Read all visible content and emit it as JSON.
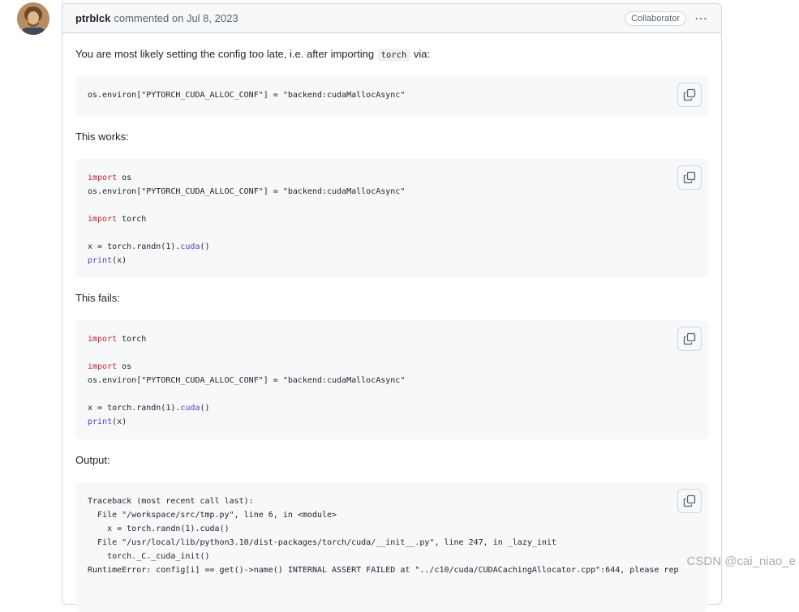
{
  "comment": {
    "author": "ptrblck",
    "meta": "commented on Jul 8, 2023",
    "badge": "Collaborator",
    "menu_icon": "kebab-horizontal-icon"
  },
  "paragraphs": {
    "intro_before": "You are most likely setting the config too late, i.e. after importing ",
    "intro_code": "torch",
    "intro_after": " via:",
    "works": "This works:",
    "fails": "This fails:",
    "output": "Output:"
  },
  "code1": {
    "l1": "os.environ[\"PYTORCH_CUDA_ALLOC_CONF\"] = \"backend:cudaMallocAsync\""
  },
  "code2": {
    "l1_kw": "import",
    "l1_rest": " os",
    "l2": "os.environ[\"PYTORCH_CUDA_ALLOC_CONF\"] = \"backend:cudaMallocAsync\"",
    "l3_kw": "import",
    "l3_rest": " torch",
    "l4_a": "x = torch.randn(1).",
    "l4_fn": "cuda",
    "l4_b": "()",
    "l5_fn": "print",
    "l5_rest": "(x)"
  },
  "code3": {
    "l1_kw": "import",
    "l1_rest": " torch",
    "l2_kw": "import",
    "l2_rest": " os",
    "l3": "os.environ[\"PYTORCH_CUDA_ALLOC_CONF\"] = \"backend:cudaMallocAsync\"",
    "l4_a": "x = torch.randn(1).",
    "l4_fn": "cuda",
    "l4_b": "()",
    "l5_fn": "print",
    "l5_rest": "(x)"
  },
  "code4": {
    "l1": "Traceback (most recent call last):",
    "l2": "  File \"/workspace/src/tmp.py\", line 6, in <module>",
    "l3": "    x = torch.randn(1).cuda()",
    "l4": "  File \"/usr/local/lib/python3.10/dist-packages/torch/cuda/__init__.py\", line 247, in _lazy_init",
    "l5": "    torch._C._cuda_init()",
    "l6": "RuntimeError: config[i] == get()->name() INTERNAL ASSERT FAILED at \"../c10/cuda/CUDACachingAllocator.cpp\":644, please rep"
  },
  "watermark": "CSDN @cai_niao_e"
}
